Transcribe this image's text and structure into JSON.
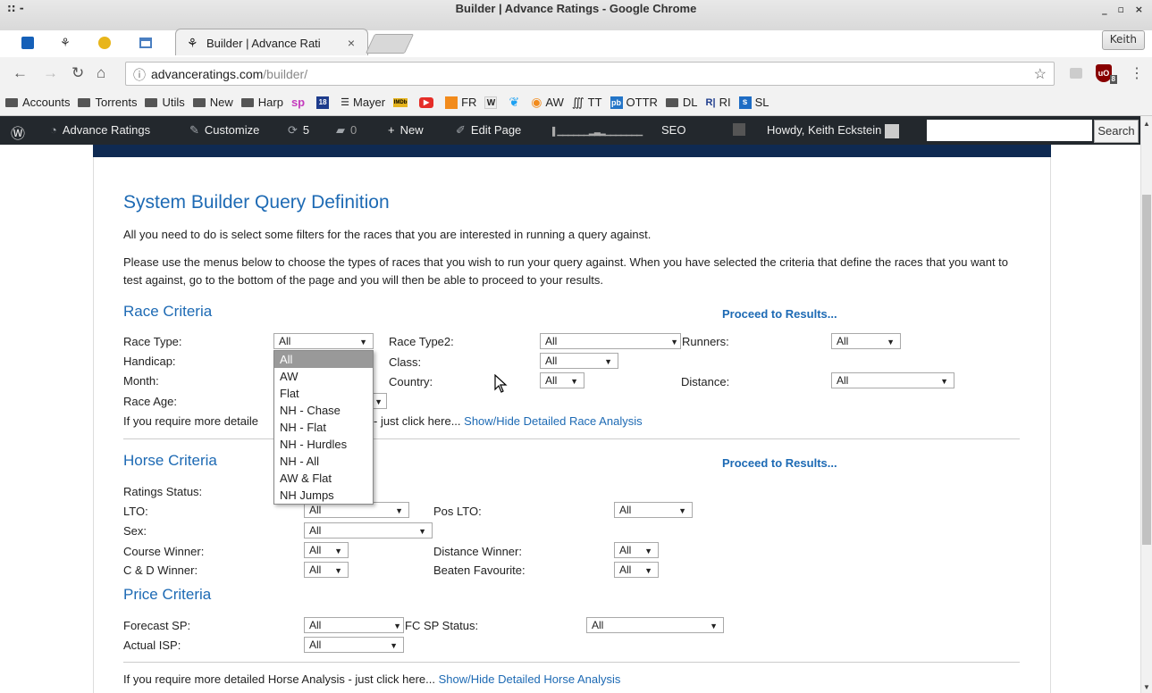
{
  "window": {
    "title": "Builder | Advance Ratings - Google Chrome",
    "wm_left": ":: -",
    "wm_right": "_ ▫ ×",
    "profile": "Keith"
  },
  "tabs": {
    "active_label": "Builder | Advance Rati",
    "close": "×"
  },
  "toolbar": {
    "url_domain": "advanceratings.com",
    "url_path": "/builder/",
    "ublock_badge": "8"
  },
  "bookmarks": [
    {
      "label": "Accounts",
      "icon": "folder-icon"
    },
    {
      "label": "Torrents",
      "icon": "folder-icon"
    },
    {
      "label": "Utils",
      "icon": "folder-icon"
    },
    {
      "label": "New",
      "icon": "folder-icon"
    },
    {
      "label": "Harp",
      "icon": "folder-icon"
    },
    {
      "label": "Mayer",
      "icon": "mayer-icon"
    },
    {
      "label": "FR",
      "icon": "fr-icon"
    },
    {
      "label": "AW",
      "icon": "aw-icon"
    },
    {
      "label": "TT",
      "icon": "tt-icon"
    },
    {
      "label": "OTTR",
      "icon": "ottr-icon"
    },
    {
      "label": "DL",
      "icon": "folder-icon"
    },
    {
      "label": "RI",
      "icon": "ri-icon"
    },
    {
      "label": "SL",
      "icon": "sl-icon"
    }
  ],
  "wpbar": {
    "site": "Advance Ratings",
    "customize": "Customize",
    "updates": "5",
    "comments": "0",
    "new": "New",
    "edit": "Edit Page",
    "seo": "SEO",
    "howdy": "Howdy, Keith Eckstein",
    "search_btn": "Search"
  },
  "page": {
    "title": "System Builder Query Definition",
    "intro1": "All you need to do is select some filters for the races that you are interested in running a query against.",
    "intro2": "Please use the menus below to choose the types of races that you wish to run your query against. When you have selected the criteria that define the races that you want to test against, go to the bottom of the page and you will then be able to proceed to your results.",
    "proceed": "Proceed to Results...",
    "race": {
      "heading": "Race Criteria",
      "race_type_label": "Race Type:",
      "race_type_value": "All",
      "race_type2_label": "Race Type2:",
      "race_type2_value": "All",
      "runners_label": "Runners:",
      "runners_value": "All",
      "handicap_label": "Handicap:",
      "class_label": "Class:",
      "class_value": "All",
      "month_label": "Month:",
      "country_label": "Country:",
      "country_value": "All",
      "distance_label": "Distance:",
      "distance_value": "All",
      "race_age_label": "Race Age:",
      "detail_prefix": "If you require more detaile",
      "detail_suffix": "- just click here...",
      "detail_link": "Show/Hide Detailed Race Analysis"
    },
    "race_type_options": [
      "All",
      "AW",
      "Flat",
      "NH - Chase",
      "NH - Flat",
      "NH - Hurdles",
      "NH - All",
      "AW & Flat",
      "NH Jumps"
    ],
    "horse": {
      "heading": "Horse Criteria",
      "ratings_status_label": "Ratings Status:",
      "lto_label": "LTO:",
      "lto_value": "All",
      "pos_lto_label": "Pos LTO:",
      "pos_lto_value": "All",
      "sex_label": "Sex:",
      "sex_value": "All",
      "course_winner_label": "Course Winner:",
      "course_winner_value": "All",
      "distance_winner_label": "Distance Winner:",
      "distance_winner_value": "All",
      "cd_winner_label": "C & D Winner:",
      "cd_winner_value": "All",
      "beaten_fav_label": "Beaten Favourite:",
      "beaten_fav_value": "All"
    },
    "price": {
      "heading": "Price Criteria",
      "forecast_sp_label": "Forecast SP:",
      "forecast_sp_value": "All",
      "fc_sp_status_label": "FC SP Status:",
      "fc_sp_status_value": "All",
      "actual_isp_label": "Actual ISP:",
      "actual_isp_value": "All"
    },
    "horse_detail_text": "If you require more detailed Horse Analysis - just click here...",
    "horse_detail_link": "Show/Hide Detailed Horse Analysis"
  }
}
